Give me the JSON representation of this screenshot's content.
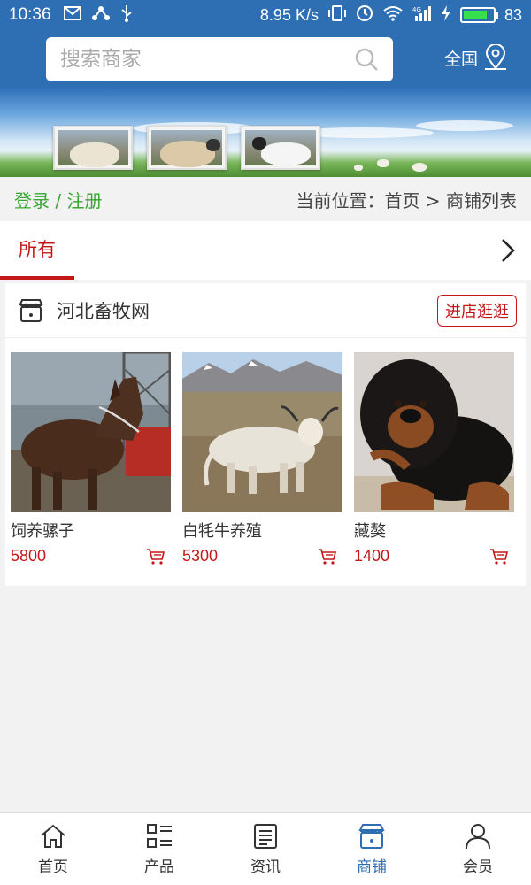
{
  "status": {
    "time": "10:36",
    "speed": "8.95 K/s",
    "battery_percent": "83",
    "battery_level": 0.83,
    "network": "4G"
  },
  "header": {
    "search_placeholder": "搜索商家",
    "region_label": "全国"
  },
  "breadcrumb": {
    "login": "登录 / 注册",
    "position": "当前位置：首页 > 商铺列表"
  },
  "tabs": [
    {
      "label": "所有",
      "active": true
    }
  ],
  "shop": {
    "name": "河北畜牧网",
    "enter_label": "进店逛逛",
    "products": [
      {
        "name": "饲养骡子",
        "price": "5800"
      },
      {
        "name": "白牦牛养殖",
        "price": "5300"
      },
      {
        "name": "藏獒",
        "price": "1400"
      }
    ]
  },
  "nav": [
    {
      "label": "首页",
      "icon": "home-icon",
      "active": false
    },
    {
      "label": "产品",
      "icon": "grid-list-icon",
      "active": false
    },
    {
      "label": "资讯",
      "icon": "news-icon",
      "active": false
    },
    {
      "label": "商铺",
      "icon": "store-icon",
      "active": true
    },
    {
      "label": "会员",
      "icon": "user-icon",
      "active": false
    }
  ],
  "colors": {
    "primary": "#2e6fb4",
    "accent": "#c41818",
    "login_green": "#3aa535"
  }
}
